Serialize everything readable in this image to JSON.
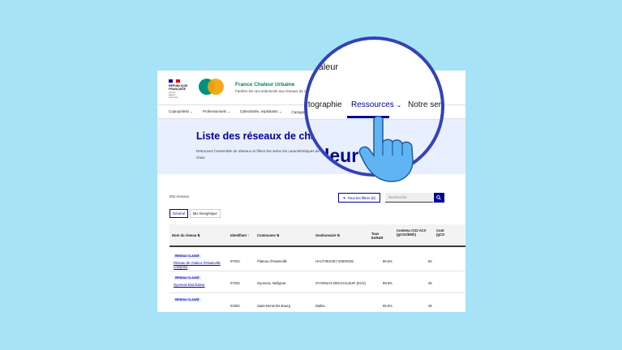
{
  "header": {
    "gov_logo_text": [
      "RÉPUBLIQUE",
      "FRANÇAISE"
    ],
    "gov_motto": [
      "Liberté",
      "Égalité",
      "Fraternité"
    ],
    "brand": "France Chaleur Urbaine",
    "tagline": "Faciliter les raccordements aux réseaux de chaleur"
  },
  "nav": [
    "Copropriétés",
    "Professionnels",
    "Collectivités, exploitants",
    "Cartographie",
    "Ressources",
    "Notre service"
  ],
  "hero": {
    "title": "Liste des réseaux de chaleur",
    "text": "Retrouvez l'ensemble de réseaux et filtrez-les selon les caractéristiques de votre choix"
  },
  "list": {
    "count": "802 réseaux",
    "filter_label": "Tous les filtres (0)",
    "search_placeholder": "Rechercher",
    "tabs": [
      "Général",
      "Mix énergétique"
    ],
    "columns": [
      "Nom du réseau",
      "Identifiant",
      "Communes",
      "Gestionnaire",
      "Taux EnR&R",
      "Contenu CO2 ACV (gCO2/kWh)",
      "Cont (gCO"
    ],
    "badge": "RÉSEAU CLASSÉ",
    "rows": [
      {
        "name": "Réseau de chaleur d'Hauteville Lompnes",
        "id": "0702C",
        "commune": "Plateau d'Hauteville",
        "gestionnaire": "HAUT-BUGEY ENERGIE",
        "enr": "86.6%",
        "co2": "80"
      },
      {
        "name": "Oyonnax BioChaleur",
        "id": "0703C",
        "commune": "Oyonnax, Bellignat",
        "gestionnaire": "OYONNAX BIOCHALEUR (ECS)",
        "enr": "89.9%",
        "co2": "45"
      },
      {
        "name": "",
        "id": "0105C",
        "commune": "Saint-Denis-lès-Bourg",
        "gestionnaire": "Dalkia",
        "enr": "55.5%",
        "co2": "45"
      }
    ]
  },
  "zoom": {
    "top": "chaleur",
    "nav": [
      "artographie",
      "Ressources",
      "Notre servic"
    ],
    "hero": "leur"
  }
}
